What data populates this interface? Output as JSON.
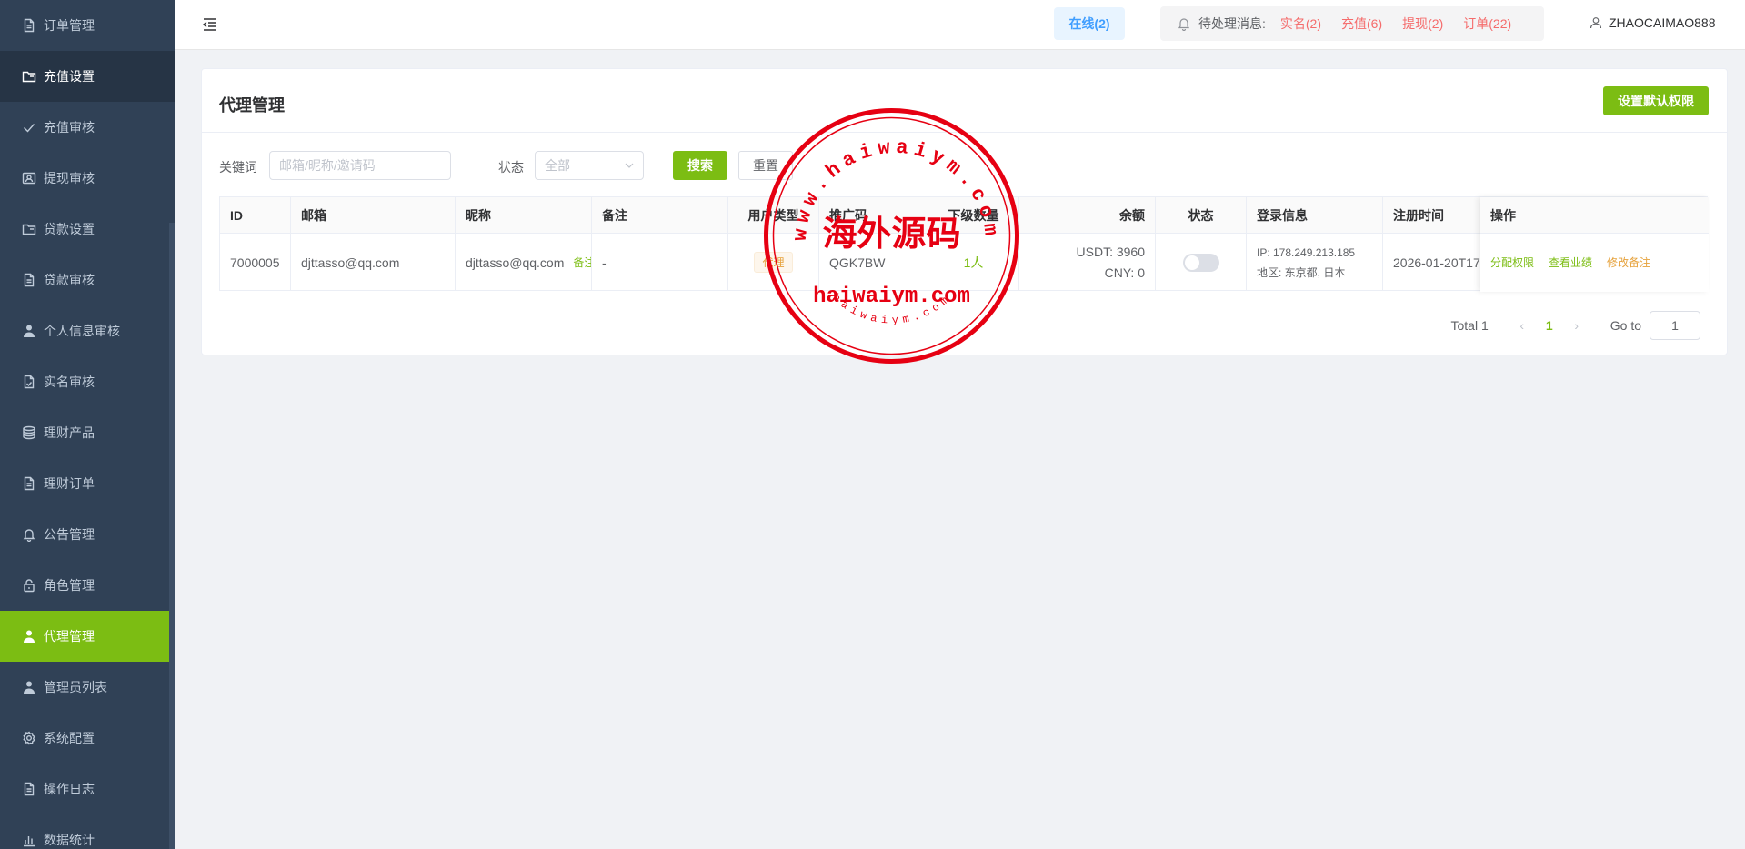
{
  "sidebar": {
    "items": [
      {
        "label": "订单管理",
        "icon": "document-icon",
        "state": ""
      },
      {
        "label": "充值设置",
        "icon": "folder-icon",
        "state": "hover"
      },
      {
        "label": "充值审核",
        "icon": "check-icon",
        "state": ""
      },
      {
        "label": "提现审核",
        "icon": "id-card-icon",
        "state": ""
      },
      {
        "label": "贷款设置",
        "icon": "folder-icon",
        "state": ""
      },
      {
        "label": "贷款审核",
        "icon": "document-icon",
        "state": ""
      },
      {
        "label": "个人信息审核",
        "icon": "user-icon",
        "state": ""
      },
      {
        "label": "实名审核",
        "icon": "document-check-icon",
        "state": ""
      },
      {
        "label": "理财产品",
        "icon": "coins-icon",
        "state": ""
      },
      {
        "label": "理财订单",
        "icon": "document-icon",
        "state": ""
      },
      {
        "label": "公告管理",
        "icon": "bell-icon",
        "state": ""
      },
      {
        "label": "角色管理",
        "icon": "lock-icon",
        "state": ""
      },
      {
        "label": "代理管理",
        "icon": "user-icon",
        "state": "active"
      },
      {
        "label": "管理员列表",
        "icon": "user-icon",
        "state": ""
      },
      {
        "label": "系统配置",
        "icon": "gear-icon",
        "state": ""
      },
      {
        "label": "操作日志",
        "icon": "document-icon",
        "state": ""
      },
      {
        "label": "数据统计",
        "icon": "chart-icon",
        "state": ""
      }
    ]
  },
  "header": {
    "online": "在线(2)",
    "pending_label": "待处理消息:",
    "pending": [
      "实名(2)",
      "充值(6)",
      "提现(2)",
      "订单(22)"
    ],
    "username": "ZHAOCAIMAO888"
  },
  "card": {
    "title": "代理管理",
    "default_perm_button": "设置默认权限"
  },
  "filter": {
    "keyword_label": "关键词",
    "keyword_placeholder": "邮箱/昵称/邀请码",
    "status_label": "状态",
    "status_value": "全部",
    "search_button": "搜索",
    "reset_button": "重置"
  },
  "table": {
    "headers": [
      "ID",
      "邮箱",
      "昵称",
      "备注",
      "用户类型",
      "推广码",
      "下级数量",
      "余额",
      "状态",
      "登录信息",
      "注册时间",
      "操作"
    ],
    "rows": [
      {
        "id": "7000005",
        "email": "djttasso@qq.com",
        "nickname": "djttasso@qq.com",
        "nickname_tag": "备注",
        "remark": "-",
        "user_type": "代理",
        "promo_code": "QGK7BW",
        "sub_count": "1人",
        "balance_usdt": "USDT: 3960",
        "balance_cny": "CNY: 0",
        "status_on": false,
        "login_ip": "IP: 178.249.213.185",
        "login_region": "地区: 东京都, 日本",
        "reg_time": "2026-01-20T17",
        "actions": [
          "分配权限",
          "查看业绩",
          "修改备注"
        ]
      }
    ]
  },
  "pagination": {
    "total": "Total 1",
    "current": "1",
    "goto_label": "Go to",
    "goto_value": "1"
  },
  "watermark": {
    "top_arc": "www.haiwaiym.com",
    "center": "海外源码",
    "middle": "haiwaiym.com",
    "bottom_arc": "haiwaiym.com",
    "color": "#e60012"
  },
  "colors": {
    "sidebar_bg": "#304156",
    "accent": "#7cbd13",
    "danger": "#f56c6c",
    "warning": "#e6a23c"
  }
}
